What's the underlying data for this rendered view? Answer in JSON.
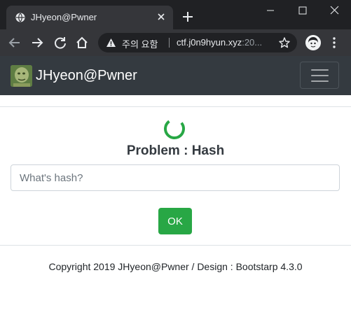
{
  "browser": {
    "tab": {
      "title": "JHyeon@Pwner",
      "favicon": "globe-icon",
      "close_icon": "close-icon"
    },
    "new_tab_icon": "plus-icon",
    "window_controls": [
      "minimize-icon",
      "maximize-icon",
      "close-icon"
    ],
    "toolbar": {
      "back_icon": "arrow-left-icon",
      "forward_icon": "arrow-right-icon",
      "reload_icon": "reload-icon",
      "home_icon": "home-icon",
      "security_label": "주의 요함",
      "url_host": "ctf.j0n9hyun.xyz",
      "url_rest": ":20...",
      "bookmark_icon": "star-icon",
      "menu_icon": "kebab-menu-icon"
    },
    "colors": {
      "tabstrip": "#202124",
      "toolbar": "#35363a"
    }
  },
  "page": {
    "navbar": {
      "brand": "JHyeon@Pwner",
      "toggler_icon": "hamburger-icon",
      "background": "#343a40"
    },
    "problem": {
      "title": "Problem : Hash",
      "spinner_color": "#28a745"
    },
    "form": {
      "input_placeholder": "What's hash?",
      "input_value": "",
      "submit_label": "OK",
      "submit_color": "#28a745"
    },
    "footer": {
      "text": "Copyright 2019 JHyeon@Pwner / Design : Bootstarp 4.3.0"
    }
  }
}
